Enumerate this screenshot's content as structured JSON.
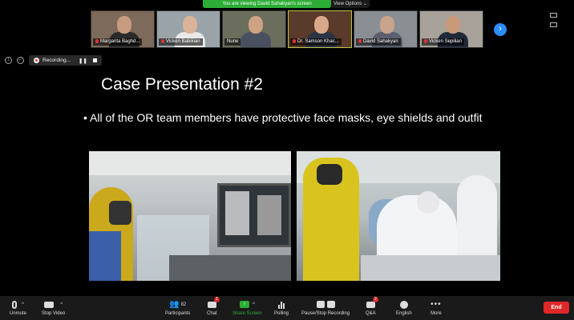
{
  "banner": {
    "viewing_text": "You are viewing David Sahakyan's screen",
    "view_options": "View Options"
  },
  "gallery": [
    {
      "name": "Margarita Baghd...",
      "bg": "#7d6a5a",
      "skin": "#c89a80",
      "shirt": "#2a2a2a",
      "muted": true
    },
    {
      "name": "Vicken Babikian",
      "bg": "#9aa3a8",
      "skin": "#d9b39a",
      "shirt": "#e8e8e8",
      "muted": true
    },
    {
      "name": "Nune",
      "bg": "#6b6e5c",
      "skin": "#cda383",
      "shirt": "#4a5060",
      "muted": false
    },
    {
      "name": "Dr. Samson Khac...",
      "bg": "#5a3a2a",
      "skin": "#d9a888",
      "shirt": "#2c3444",
      "muted": true
    },
    {
      "name": "David Sahakyan",
      "bg": "#8a8f94",
      "skin": "#caa38c",
      "shirt": "#5a6070",
      "muted": true
    },
    {
      "name": "Vicken Sepilian",
      "bg": "#a8a29a",
      "skin": "#c99a7a",
      "shirt": "#1f2a3a",
      "muted": true
    }
  ],
  "recording": {
    "label": "Recording..."
  },
  "slide": {
    "title": "Case Presentation #2",
    "bullet": "• All of the OR team members have protective face masks, eye shields and outfit"
  },
  "toolbar": {
    "unmute": "Unmute",
    "stop_video": "Stop Video",
    "participants": "Participants",
    "participants_count": "82",
    "chat": "Chat",
    "chat_badge": "1",
    "share_screen": "Share Screen",
    "polling": "Polling",
    "recording": "Pause/Stop Recording",
    "qa": "Q&A",
    "qa_badge": "2",
    "language": "English",
    "more": "More",
    "end": "End"
  },
  "colors": {
    "accent": "#2d8cff",
    "share_green": "#2dad36",
    "end_red": "#e02828"
  }
}
